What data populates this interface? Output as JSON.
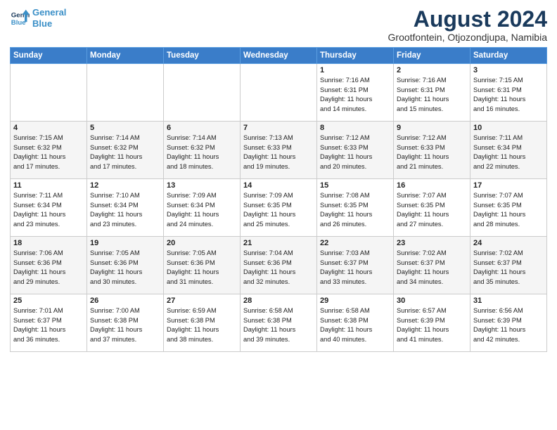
{
  "header": {
    "logo_line1": "General",
    "logo_line2": "Blue",
    "month_year": "August 2024",
    "location": "Grootfontein, Otjozondjupa, Namibia"
  },
  "days_of_week": [
    "Sunday",
    "Monday",
    "Tuesday",
    "Wednesday",
    "Thursday",
    "Friday",
    "Saturday"
  ],
  "weeks": [
    [
      {
        "day": "",
        "info": ""
      },
      {
        "day": "",
        "info": ""
      },
      {
        "day": "",
        "info": ""
      },
      {
        "day": "",
        "info": ""
      },
      {
        "day": "1",
        "info": "Sunrise: 7:16 AM\nSunset: 6:31 PM\nDaylight: 11 hours\nand 14 minutes."
      },
      {
        "day": "2",
        "info": "Sunrise: 7:16 AM\nSunset: 6:31 PM\nDaylight: 11 hours\nand 15 minutes."
      },
      {
        "day": "3",
        "info": "Sunrise: 7:15 AM\nSunset: 6:31 PM\nDaylight: 11 hours\nand 16 minutes."
      }
    ],
    [
      {
        "day": "4",
        "info": "Sunrise: 7:15 AM\nSunset: 6:32 PM\nDaylight: 11 hours\nand 17 minutes."
      },
      {
        "day": "5",
        "info": "Sunrise: 7:14 AM\nSunset: 6:32 PM\nDaylight: 11 hours\nand 17 minutes."
      },
      {
        "day": "6",
        "info": "Sunrise: 7:14 AM\nSunset: 6:32 PM\nDaylight: 11 hours\nand 18 minutes."
      },
      {
        "day": "7",
        "info": "Sunrise: 7:13 AM\nSunset: 6:33 PM\nDaylight: 11 hours\nand 19 minutes."
      },
      {
        "day": "8",
        "info": "Sunrise: 7:12 AM\nSunset: 6:33 PM\nDaylight: 11 hours\nand 20 minutes."
      },
      {
        "day": "9",
        "info": "Sunrise: 7:12 AM\nSunset: 6:33 PM\nDaylight: 11 hours\nand 21 minutes."
      },
      {
        "day": "10",
        "info": "Sunrise: 7:11 AM\nSunset: 6:34 PM\nDaylight: 11 hours\nand 22 minutes."
      }
    ],
    [
      {
        "day": "11",
        "info": "Sunrise: 7:11 AM\nSunset: 6:34 PM\nDaylight: 11 hours\nand 23 minutes."
      },
      {
        "day": "12",
        "info": "Sunrise: 7:10 AM\nSunset: 6:34 PM\nDaylight: 11 hours\nand 23 minutes."
      },
      {
        "day": "13",
        "info": "Sunrise: 7:09 AM\nSunset: 6:34 PM\nDaylight: 11 hours\nand 24 minutes."
      },
      {
        "day": "14",
        "info": "Sunrise: 7:09 AM\nSunset: 6:35 PM\nDaylight: 11 hours\nand 25 minutes."
      },
      {
        "day": "15",
        "info": "Sunrise: 7:08 AM\nSunset: 6:35 PM\nDaylight: 11 hours\nand 26 minutes."
      },
      {
        "day": "16",
        "info": "Sunrise: 7:07 AM\nSunset: 6:35 PM\nDaylight: 11 hours\nand 27 minutes."
      },
      {
        "day": "17",
        "info": "Sunrise: 7:07 AM\nSunset: 6:35 PM\nDaylight: 11 hours\nand 28 minutes."
      }
    ],
    [
      {
        "day": "18",
        "info": "Sunrise: 7:06 AM\nSunset: 6:36 PM\nDaylight: 11 hours\nand 29 minutes."
      },
      {
        "day": "19",
        "info": "Sunrise: 7:05 AM\nSunset: 6:36 PM\nDaylight: 11 hours\nand 30 minutes."
      },
      {
        "day": "20",
        "info": "Sunrise: 7:05 AM\nSunset: 6:36 PM\nDaylight: 11 hours\nand 31 minutes."
      },
      {
        "day": "21",
        "info": "Sunrise: 7:04 AM\nSunset: 6:36 PM\nDaylight: 11 hours\nand 32 minutes."
      },
      {
        "day": "22",
        "info": "Sunrise: 7:03 AM\nSunset: 6:37 PM\nDaylight: 11 hours\nand 33 minutes."
      },
      {
        "day": "23",
        "info": "Sunrise: 7:02 AM\nSunset: 6:37 PM\nDaylight: 11 hours\nand 34 minutes."
      },
      {
        "day": "24",
        "info": "Sunrise: 7:02 AM\nSunset: 6:37 PM\nDaylight: 11 hours\nand 35 minutes."
      }
    ],
    [
      {
        "day": "25",
        "info": "Sunrise: 7:01 AM\nSunset: 6:37 PM\nDaylight: 11 hours\nand 36 minutes."
      },
      {
        "day": "26",
        "info": "Sunrise: 7:00 AM\nSunset: 6:38 PM\nDaylight: 11 hours\nand 37 minutes."
      },
      {
        "day": "27",
        "info": "Sunrise: 6:59 AM\nSunset: 6:38 PM\nDaylight: 11 hours\nand 38 minutes."
      },
      {
        "day": "28",
        "info": "Sunrise: 6:58 AM\nSunset: 6:38 PM\nDaylight: 11 hours\nand 39 minutes."
      },
      {
        "day": "29",
        "info": "Sunrise: 6:58 AM\nSunset: 6:38 PM\nDaylight: 11 hours\nand 40 minutes."
      },
      {
        "day": "30",
        "info": "Sunrise: 6:57 AM\nSunset: 6:39 PM\nDaylight: 11 hours\nand 41 minutes."
      },
      {
        "day": "31",
        "info": "Sunrise: 6:56 AM\nSunset: 6:39 PM\nDaylight: 11 hours\nand 42 minutes."
      }
    ]
  ]
}
